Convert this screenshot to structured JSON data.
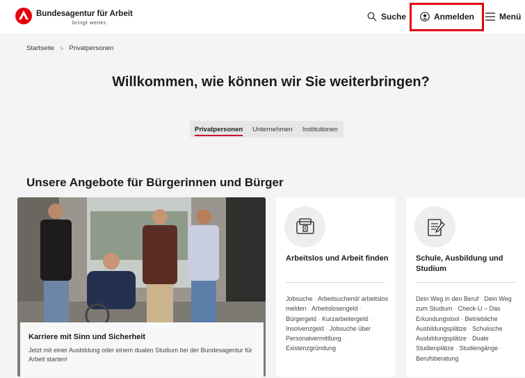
{
  "header": {
    "brand_name": "Bundesagentur für Arbeit",
    "brand_slogan": "bringt weiter.",
    "search_label": "Suche",
    "login_label": "Anmelden",
    "menu_label": "Menü",
    "highlight_color": "#e3000f"
  },
  "breadcrumb": {
    "home": "Startseite",
    "current": "Privatpersonen"
  },
  "page_title": "Willkommen, wie können wir Sie weiterbringen?",
  "tabs": [
    {
      "label": "Privatpersonen",
      "active": true
    },
    {
      "label": "Unternehmen",
      "active": false
    },
    {
      "label": "Institutionen",
      "active": false
    }
  ],
  "section_title": "Unsere Angebote für Bürgerinnen und Bürger",
  "hero": {
    "title": "Karriere mit Sinn und Sicherheit",
    "text": "Jetzt mit einer Ausbildung oder einem dualen Studium bei der Bundesagentur für Arbeit starten!"
  },
  "cards": [
    {
      "icon": "document-search-icon",
      "title": "Arbeitslos und Arbeit finden",
      "links": [
        "Jobsuche",
        "Arbeitsuchend/ arbeitslos melden",
        "Arbeitslosengeld",
        "Bürgergeld",
        "Kurzarbeitergeld",
        "Insolvenzgeld",
        "Jobsuche über Personalvermittlung",
        "Existenzgründung"
      ]
    },
    {
      "icon": "pencil-notepad-icon",
      "title": "Schule, Ausbildung und Studium",
      "links": [
        "Dein Weg in den Beruf",
        "Dein Weg zum Studium",
        "Check-U – Das Erkundungstool",
        "Betriebliche Ausbildungsplätze",
        "Schulische Ausbildungsplätze",
        "Duale Studienplätze",
        "Studiengänge",
        "Berufsberatung"
      ]
    }
  ]
}
